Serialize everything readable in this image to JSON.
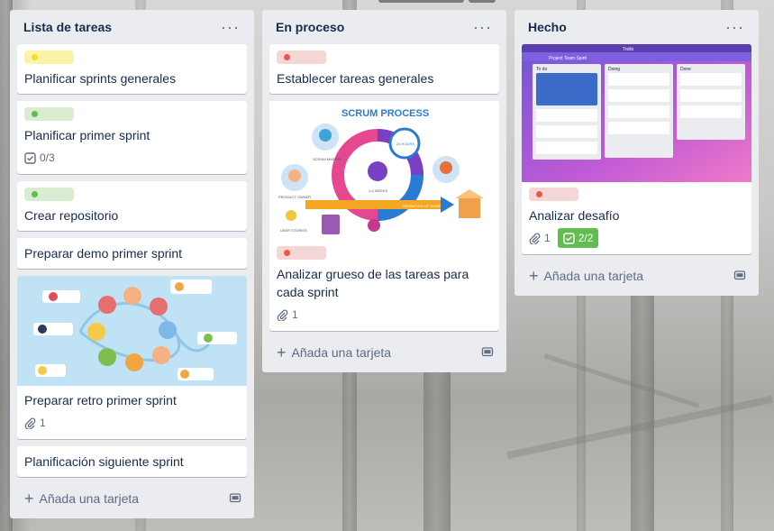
{
  "lists": [
    {
      "title": "Lista de tareas",
      "add_card_label": "Añada una tarjeta",
      "cards": [
        {
          "title": "Planificar sprints generales",
          "label_color": "yellow"
        },
        {
          "title": "Planificar primer sprint",
          "label_color": "green",
          "checklist": "0/3"
        },
        {
          "title": "Crear repositorio",
          "label_color": "green"
        },
        {
          "title": "Preparar demo primer sprint"
        },
        {
          "title": "Preparar retro primer sprint",
          "cover": "retro-illustration",
          "attachments": "1"
        },
        {
          "title": "Planificación siguiente sprint"
        }
      ]
    },
    {
      "title": "En proceso",
      "add_card_label": "Añada una tarjeta",
      "cards": [
        {
          "title": "Establecer tareas generales",
          "label_color": "red"
        },
        {
          "title": "Analizar grueso de las tareas para cada sprint",
          "label_color": "red",
          "cover": "scrum-process",
          "attachments": "1"
        }
      ],
      "cover_text": {
        "heading": "SCRUM PROCESS",
        "hours": "24 HOURS",
        "weeks": "1-4 WEEKS",
        "scrum_master": "SCRUM MASTER",
        "product_owner": "PRODUCT OWNER",
        "user_stories": "USER STORIES",
        "definition_of_done": "DEFINITION OF DONE"
      }
    },
    {
      "title": "Hecho",
      "add_card_label": "Añada una tarjeta",
      "cards": [
        {
          "title": "Analizar desafío",
          "label_color": "red",
          "cover": "trello-board-screenshot",
          "attachments": "1",
          "checklist": "2/2"
        }
      ],
      "cover_text": {
        "app": "Trello",
        "board": "Project Team Spirit",
        "col1": "To do",
        "col2": "Doing",
        "col3": "Done"
      }
    }
  ],
  "icons": {
    "menu": "ellipsis-icon",
    "add": "plus-icon",
    "template": "card-template-icon",
    "checklist": "checkbox-icon",
    "attachment": "paperclip-icon"
  },
  "colors": {
    "list_bg": "#ebecf0",
    "card_bg": "#ffffff",
    "text": "#172b4d",
    "muted": "#5e6c84",
    "label_green": "#61bd4f",
    "label_yellow": "#f5dd29",
    "label_red": "#eb5a46"
  }
}
